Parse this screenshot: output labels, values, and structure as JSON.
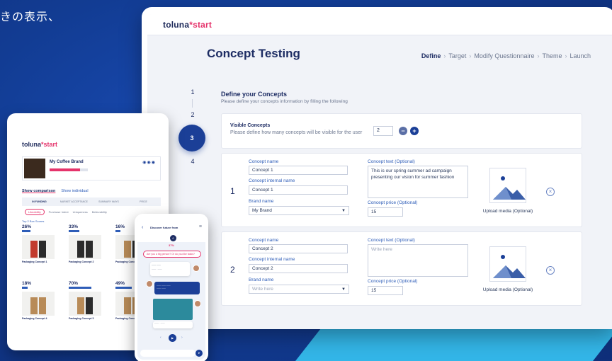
{
  "hero_text": "きの表示、",
  "desktop": {
    "logo_main": "toluna",
    "logo_accent": "start",
    "page_title": "Concept Testing",
    "breadcrumb": [
      "Define",
      "Target",
      "Modify Questionnaire",
      "Theme",
      "Launch"
    ],
    "steps": [
      "1",
      "2",
      "3",
      "4"
    ],
    "active_step": "3",
    "section_title": "Define your Concepts",
    "section_subtitle": "Please define your concepts information by filling the following",
    "visible_concepts": {
      "title": "Visible Concepts",
      "subtitle": "Please define how many concepts will be visible for the user",
      "count": "2",
      "minus": "−",
      "plus": "+"
    },
    "labels": {
      "concept_name": "Concept name",
      "concept_internal_name": "Concept internal name",
      "brand_name": "Brand name",
      "concept_text": "Concept text (Optional)",
      "concept_price": "Concept price (Optional)",
      "upload_media": "Upload media (Optional)"
    },
    "concepts": [
      {
        "number": "1",
        "name": "Concept 1",
        "internal_name": "Concept 1",
        "brand": "My Brand",
        "text": "This is our spring summer ad campaign presenting our vision for summer fashion",
        "price": "15"
      },
      {
        "number": "2",
        "name": "Concept 2",
        "internal_name": "Concept 2",
        "brand": "Write here",
        "text": "Write here",
        "price": "15"
      }
    ]
  },
  "tablet": {
    "logo_main": "toluna",
    "logo_accent": "start",
    "brand_name": "My Coffee Brand",
    "progress": 0.8,
    "links": [
      "Show comparison",
      "Show individual"
    ],
    "tabs": [
      "IN FUNDING",
      "MARKET ACCEPTANCE",
      "SUMMARY WAYS",
      "PRICE"
    ],
    "chips": [
      "Likeability",
      "Purchase Intent",
      "Uniqueness",
      "Believability"
    ],
    "sub_label": "Top 2 Box Scores",
    "tiles": [
      {
        "pct": "26%",
        "name": "Packaging Concept 1",
        "kind": "r"
      },
      {
        "pct": "33%",
        "name": "Packaging Concept 2",
        "kind": "d"
      },
      {
        "pct": "16%",
        "name": "Packaging Concept 3",
        "kind": "k"
      },
      {
        "pct": "18%",
        "name": "Packaging Concept 4",
        "kind": "k"
      },
      {
        "pct": "70%",
        "name": "Packaging Concept 5",
        "kind": "k"
      },
      {
        "pct": "49%",
        "name": "Packaging Concept 6",
        "kind": "k"
      }
    ]
  },
  "phone": {
    "title": "Discover future from",
    "pct": "37%",
    "question": "Are you a big person? Or do you like tasks?",
    "send": "Send"
  },
  "colors": {
    "background": "#123c93",
    "primary": "#1b3f97",
    "accent": "#e5336b",
    "stripe": "#33b6e8"
  }
}
